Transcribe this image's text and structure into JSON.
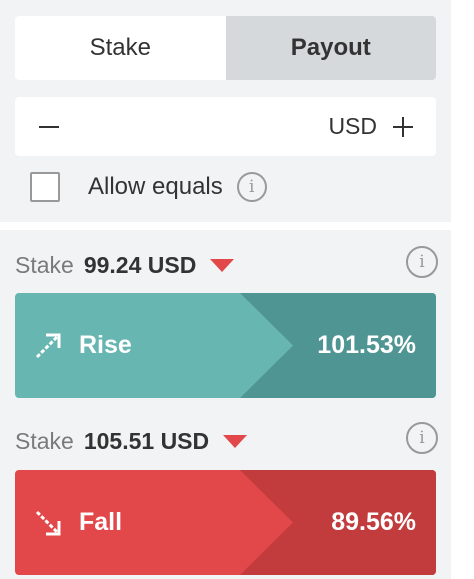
{
  "tabs": {
    "stake_label": "Stake",
    "payout_label": "Payout",
    "active": "Payout"
  },
  "amount": {
    "currency": "USD"
  },
  "allow_equals": {
    "label": "Allow equals",
    "checked": false
  },
  "rise": {
    "stake_label": "Stake",
    "stake_value": "99.24 USD",
    "label": "Rise",
    "percent": "101.53%"
  },
  "fall": {
    "stake_label": "Stake",
    "stake_value": "105.51 USD",
    "label": "Fall",
    "percent": "89.56%"
  },
  "icons": [
    "minus-icon",
    "plus-icon",
    "info-icon",
    "caret-down-icon",
    "arrow-up-right-icon",
    "arrow-down-right-icon"
  ],
  "colors": {
    "rise_main": "#68b6b2",
    "rise_dark": "#4f9593",
    "fall_main": "#e2474a",
    "fall_dark": "#c23b3d",
    "caret": "#e2474a"
  }
}
